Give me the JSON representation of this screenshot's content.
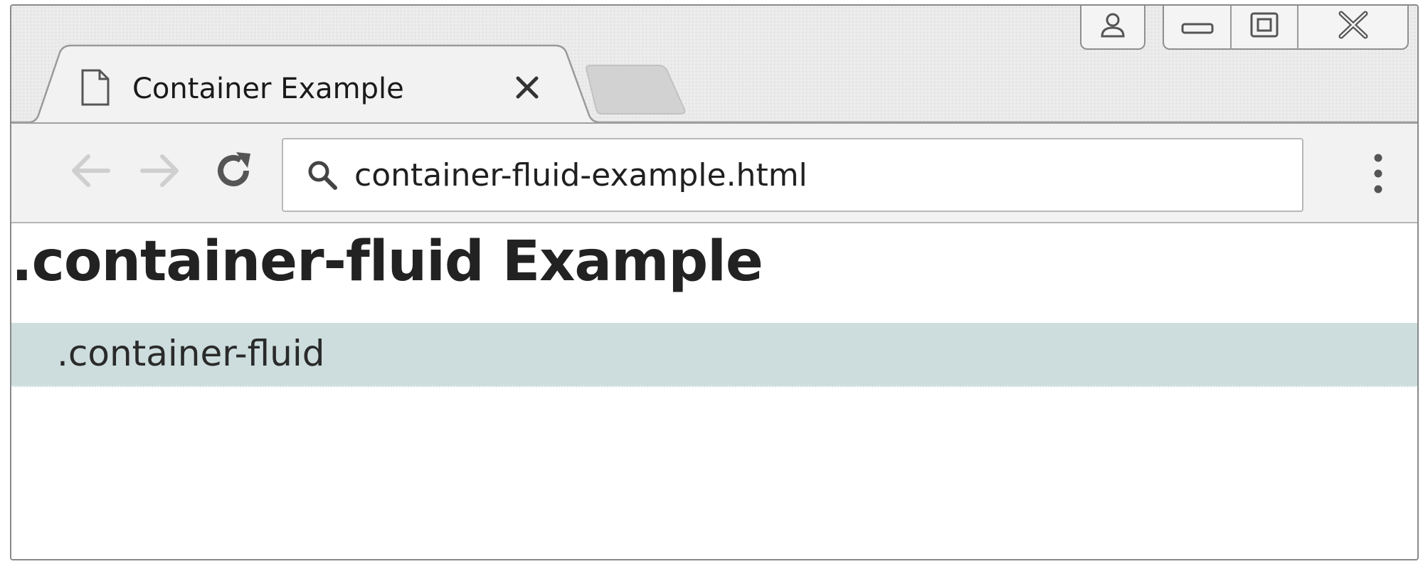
{
  "browser": {
    "tab": {
      "title": "Container Example",
      "close_label": "×"
    },
    "address_bar": {
      "value": "container-fluid-example.html"
    },
    "icons": {
      "tab": "page-icon",
      "back": "back-arrow-icon",
      "forward": "forward-arrow-icon",
      "reload": "reload-icon",
      "search": "search-icon",
      "menu": "vertical-dots-icon",
      "user": "user-icon",
      "minimize": "minimize-icon",
      "maximize": "maximize-icon",
      "close_window": "close-window-icon"
    }
  },
  "page": {
    "heading": ".container-fluid Example",
    "container_label": ".container-fluid"
  },
  "colors": {
    "container_background": "#cddcdc",
    "heading_text": "#222222",
    "toolbar_background": "#f2f2f2"
  }
}
